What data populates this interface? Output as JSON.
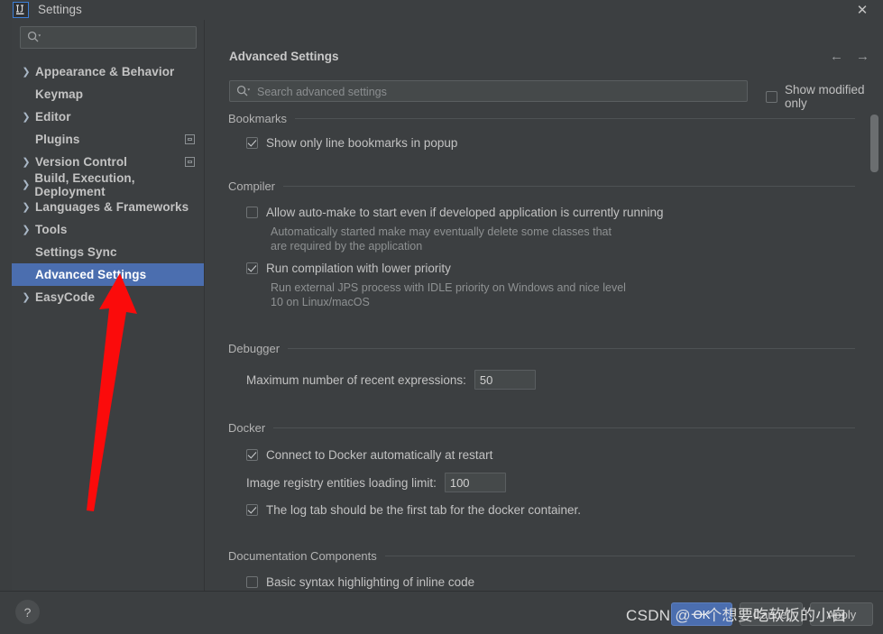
{
  "window": {
    "title": "Settings",
    "app_icon": "intellij-idea-icon",
    "close_label": "✕"
  },
  "sidebar": {
    "search": {
      "value": "",
      "placeholder": "",
      "icon": "search-icon"
    },
    "items": [
      {
        "label": "Appearance & Behavior",
        "expandable": true,
        "selected": false,
        "side_icon": false
      },
      {
        "label": "Keymap",
        "expandable": false,
        "selected": false,
        "side_icon": false
      },
      {
        "label": "Editor",
        "expandable": true,
        "selected": false,
        "side_icon": false
      },
      {
        "label": "Plugins",
        "expandable": false,
        "selected": false,
        "side_icon": true
      },
      {
        "label": "Version Control",
        "expandable": true,
        "selected": false,
        "side_icon": true
      },
      {
        "label": "Build, Execution, Deployment",
        "expandable": true,
        "selected": false,
        "side_icon": false
      },
      {
        "label": "Languages & Frameworks",
        "expandable": true,
        "selected": false,
        "side_icon": false
      },
      {
        "label": "Tools",
        "expandable": true,
        "selected": false,
        "side_icon": false
      },
      {
        "label": "Settings Sync",
        "expandable": false,
        "selected": false,
        "side_icon": false
      },
      {
        "label": "Advanced Settings",
        "expandable": false,
        "selected": true,
        "side_icon": false
      },
      {
        "label": "EasyCode",
        "expandable": true,
        "selected": false,
        "side_icon": false
      }
    ]
  },
  "main": {
    "title": "Advanced Settings",
    "back_arrow": "←",
    "forward_arrow": "→",
    "search": {
      "value": "",
      "placeholder": "Search advanced settings",
      "icon": "search-icon"
    },
    "show_modified_only": {
      "label": "Show modified only",
      "checked": false
    },
    "sections": [
      {
        "name": "Bookmarks",
        "options": [
          {
            "type": "checkbox",
            "label": "Show only line bookmarks in popup",
            "checked": true,
            "description": ""
          }
        ]
      },
      {
        "name": "Compiler",
        "options": [
          {
            "type": "checkbox",
            "label": "Allow auto-make to start even if developed application is currently running",
            "checked": false,
            "description": "Automatically started make may eventually delete some classes that\nare required by the application"
          },
          {
            "type": "checkbox",
            "label": "Run compilation with lower priority",
            "checked": true,
            "description": "Run external JPS process with IDLE priority on Windows and nice level\n10 on Linux/macOS"
          }
        ]
      },
      {
        "name": "Debugger",
        "options": [
          {
            "type": "field",
            "label": "Maximum number of recent expressions:",
            "value": "50",
            "description": ""
          }
        ]
      },
      {
        "name": "Docker",
        "options": [
          {
            "type": "checkbox",
            "label": "Connect to Docker automatically at restart",
            "checked": true,
            "description": ""
          },
          {
            "type": "field",
            "label": "Image registry entities loading limit:",
            "value": "100",
            "description": ""
          },
          {
            "type": "checkbox",
            "label": "The log tab should be the first tab for the docker container.",
            "checked": true,
            "description": ""
          }
        ]
      },
      {
        "name": "Documentation Components",
        "options": [
          {
            "type": "checkbox",
            "label": "Basic syntax highlighting of inline code",
            "checked": false,
            "description": ""
          }
        ]
      }
    ]
  },
  "footer": {
    "help_label": "?",
    "ok_label": "OK",
    "cancel_label": "Cancel",
    "apply_label": "Apply"
  },
  "watermark": {
    "text": "CSDN @一个想要吃软饭的小白"
  },
  "annotation": {
    "type": "red-arrow",
    "points_to": "Advanced Settings",
    "color": "#fb0b0b"
  },
  "colors": {
    "accent": "#4b6eaf",
    "dialog_bg": "#3c3f41",
    "field_bg": "#45494a",
    "text": "#bbbbbb",
    "muted_text": "#8e9192",
    "annotation_red": "#fb0b0b"
  }
}
